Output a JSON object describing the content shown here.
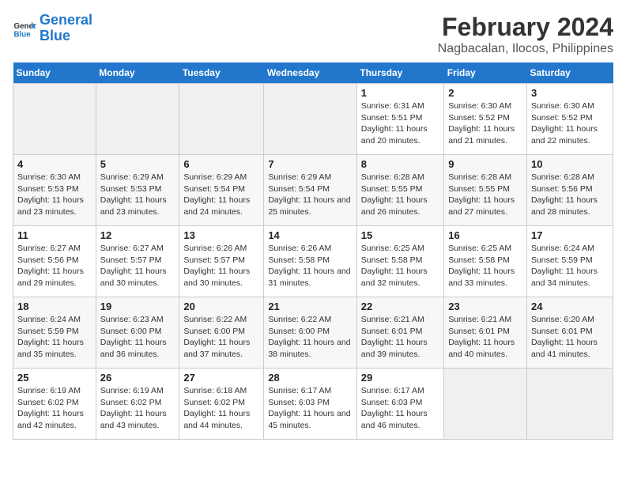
{
  "header": {
    "logo_line1": "General",
    "logo_line2": "Blue",
    "title": "February 2024",
    "subtitle": "Nagbacalan, Ilocos, Philippines"
  },
  "columns": [
    "Sunday",
    "Monday",
    "Tuesday",
    "Wednesday",
    "Thursday",
    "Friday",
    "Saturday"
  ],
  "weeks": [
    [
      {
        "day": "",
        "info": ""
      },
      {
        "day": "",
        "info": ""
      },
      {
        "day": "",
        "info": ""
      },
      {
        "day": "",
        "info": ""
      },
      {
        "day": "1",
        "info": "Sunrise: 6:31 AM\nSunset: 5:51 PM\nDaylight: 11 hours and 20 minutes."
      },
      {
        "day": "2",
        "info": "Sunrise: 6:30 AM\nSunset: 5:52 PM\nDaylight: 11 hours and 21 minutes."
      },
      {
        "day": "3",
        "info": "Sunrise: 6:30 AM\nSunset: 5:52 PM\nDaylight: 11 hours and 22 minutes."
      }
    ],
    [
      {
        "day": "4",
        "info": "Sunrise: 6:30 AM\nSunset: 5:53 PM\nDaylight: 11 hours and 23 minutes."
      },
      {
        "day": "5",
        "info": "Sunrise: 6:29 AM\nSunset: 5:53 PM\nDaylight: 11 hours and 23 minutes."
      },
      {
        "day": "6",
        "info": "Sunrise: 6:29 AM\nSunset: 5:54 PM\nDaylight: 11 hours and 24 minutes."
      },
      {
        "day": "7",
        "info": "Sunrise: 6:29 AM\nSunset: 5:54 PM\nDaylight: 11 hours and 25 minutes."
      },
      {
        "day": "8",
        "info": "Sunrise: 6:28 AM\nSunset: 5:55 PM\nDaylight: 11 hours and 26 minutes."
      },
      {
        "day": "9",
        "info": "Sunrise: 6:28 AM\nSunset: 5:55 PM\nDaylight: 11 hours and 27 minutes."
      },
      {
        "day": "10",
        "info": "Sunrise: 6:28 AM\nSunset: 5:56 PM\nDaylight: 11 hours and 28 minutes."
      }
    ],
    [
      {
        "day": "11",
        "info": "Sunrise: 6:27 AM\nSunset: 5:56 PM\nDaylight: 11 hours and 29 minutes."
      },
      {
        "day": "12",
        "info": "Sunrise: 6:27 AM\nSunset: 5:57 PM\nDaylight: 11 hours and 30 minutes."
      },
      {
        "day": "13",
        "info": "Sunrise: 6:26 AM\nSunset: 5:57 PM\nDaylight: 11 hours and 30 minutes."
      },
      {
        "day": "14",
        "info": "Sunrise: 6:26 AM\nSunset: 5:58 PM\nDaylight: 11 hours and 31 minutes."
      },
      {
        "day": "15",
        "info": "Sunrise: 6:25 AM\nSunset: 5:58 PM\nDaylight: 11 hours and 32 minutes."
      },
      {
        "day": "16",
        "info": "Sunrise: 6:25 AM\nSunset: 5:58 PM\nDaylight: 11 hours and 33 minutes."
      },
      {
        "day": "17",
        "info": "Sunrise: 6:24 AM\nSunset: 5:59 PM\nDaylight: 11 hours and 34 minutes."
      }
    ],
    [
      {
        "day": "18",
        "info": "Sunrise: 6:24 AM\nSunset: 5:59 PM\nDaylight: 11 hours and 35 minutes."
      },
      {
        "day": "19",
        "info": "Sunrise: 6:23 AM\nSunset: 6:00 PM\nDaylight: 11 hours and 36 minutes."
      },
      {
        "day": "20",
        "info": "Sunrise: 6:22 AM\nSunset: 6:00 PM\nDaylight: 11 hours and 37 minutes."
      },
      {
        "day": "21",
        "info": "Sunrise: 6:22 AM\nSunset: 6:00 PM\nDaylight: 11 hours and 38 minutes."
      },
      {
        "day": "22",
        "info": "Sunrise: 6:21 AM\nSunset: 6:01 PM\nDaylight: 11 hours and 39 minutes."
      },
      {
        "day": "23",
        "info": "Sunrise: 6:21 AM\nSunset: 6:01 PM\nDaylight: 11 hours and 40 minutes."
      },
      {
        "day": "24",
        "info": "Sunrise: 6:20 AM\nSunset: 6:01 PM\nDaylight: 11 hours and 41 minutes."
      }
    ],
    [
      {
        "day": "25",
        "info": "Sunrise: 6:19 AM\nSunset: 6:02 PM\nDaylight: 11 hours and 42 minutes."
      },
      {
        "day": "26",
        "info": "Sunrise: 6:19 AM\nSunset: 6:02 PM\nDaylight: 11 hours and 43 minutes."
      },
      {
        "day": "27",
        "info": "Sunrise: 6:18 AM\nSunset: 6:02 PM\nDaylight: 11 hours and 44 minutes."
      },
      {
        "day": "28",
        "info": "Sunrise: 6:17 AM\nSunset: 6:03 PM\nDaylight: 11 hours and 45 minutes."
      },
      {
        "day": "29",
        "info": "Sunrise: 6:17 AM\nSunset: 6:03 PM\nDaylight: 11 hours and 46 minutes."
      },
      {
        "day": "",
        "info": ""
      },
      {
        "day": "",
        "info": ""
      }
    ]
  ]
}
